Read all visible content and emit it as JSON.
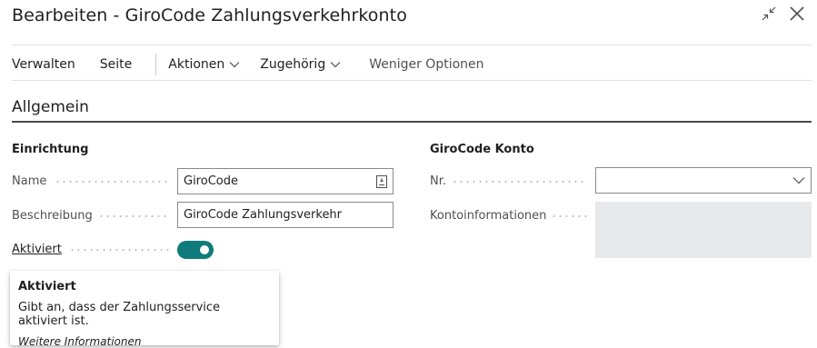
{
  "window": {
    "title": "Bearbeiten - GiroCode Zahlungsverkehrkonto",
    "collapse_icon": "collapse-arrows-icon",
    "close_icon": "close-icon"
  },
  "actions": {
    "items": [
      {
        "label": "Verwalten"
      },
      {
        "label": "Seite"
      },
      {
        "label": "Aktionen",
        "has_dropdown": true
      },
      {
        "label": "Zugehörig",
        "has_dropdown": true
      },
      {
        "label": "Weniger Optionen"
      }
    ]
  },
  "section": {
    "title": "Allgemein"
  },
  "setup": {
    "group_title": "Einrichtung",
    "name_label": "Name",
    "name_value": "GiroCode",
    "name_icon": "lookup-icon",
    "description_label": "Beschreibung",
    "description_value": "GiroCode Zahlungsverkehr",
    "enabled_label": "Aktiviert",
    "enabled": true
  },
  "account": {
    "group_title": "GiroCode Konto",
    "number_label": "Nr.",
    "number_value": "",
    "account_info_label": "Kontoinformationen",
    "account_info_value": ""
  },
  "tooltip": {
    "title": "Aktiviert",
    "text": "Gibt an, dass der Zahlungsservice aktiviert ist.",
    "link": "Weitere Informationen"
  },
  "colors": {
    "toggle_on": "#0f7b7a",
    "readonly_bg": "#e8e9ea",
    "section_rule": "#4a4a4a"
  }
}
